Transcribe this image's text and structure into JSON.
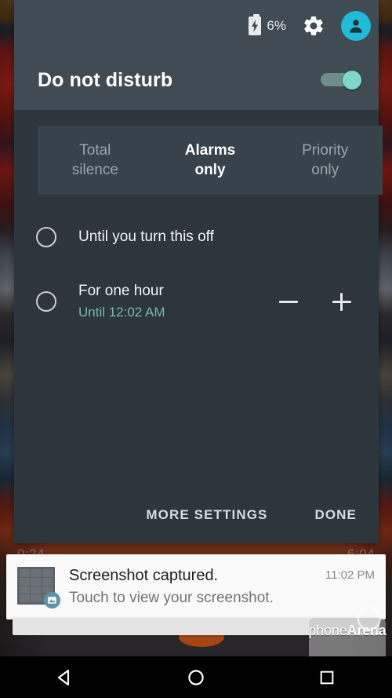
{
  "status_bar": {
    "battery_percent": "6%",
    "battery_icon": "battery-charging-icon",
    "settings_icon": "gear-icon",
    "avatar_icon": "user-avatar-icon"
  },
  "dnd": {
    "title": "Do not disturb",
    "toggle_on": true,
    "toggle_on_color": "#7fd6cd",
    "modes": [
      {
        "line1": "Total",
        "line2": "silence",
        "selected": false
      },
      {
        "line1": "Alarms",
        "line2": "only",
        "selected": true
      },
      {
        "line1": "Priority",
        "line2": "only",
        "selected": false
      }
    ],
    "duration_options": [
      {
        "title": "Until you turn this off",
        "subtitle": "",
        "selected": false,
        "has_stepper": false
      },
      {
        "title": "For one hour",
        "subtitle": "Until 12:02 AM",
        "selected": false,
        "has_stepper": true
      }
    ],
    "stepper": {
      "decrease_label": "−",
      "increase_label": "+"
    },
    "accent_color": "#74b7ae",
    "actions": {
      "more_settings": "MORE SETTINGS",
      "done": "DONE"
    }
  },
  "behind_panel": {
    "left_text": "0:24",
    "right_text": "6:04"
  },
  "notification": {
    "title": "Screenshot captured.",
    "text": "Touch to view your screenshot.",
    "time": "11:02 PM",
    "thumbnail_icon": "screenshot-thumbnail",
    "badge_icon": "photo-icon"
  },
  "navbar": {
    "back": "back-triangle-icon",
    "home": "home-circle-icon",
    "recents": "recents-square-icon"
  },
  "watermark": {
    "text_light": "phone",
    "text_bold": "Arena"
  }
}
